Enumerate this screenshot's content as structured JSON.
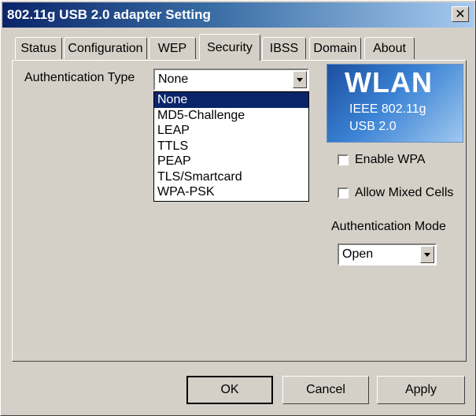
{
  "window": {
    "title": "802.11g USB 2.0 adapter Setting",
    "close_label": "✕"
  },
  "tabs": [
    "Status",
    "Configuration",
    "WEP",
    "Security",
    "IBSS",
    "Domain",
    "About"
  ],
  "active_tab": "Security",
  "security": {
    "auth_type_label": "Authentication Type",
    "auth_type_value": "None",
    "auth_type_options": [
      "None",
      "MD5-Challenge",
      "LEAP",
      "TTLS",
      "PEAP",
      "TLS/Smartcard",
      "WPA-PSK"
    ],
    "logo_title": "WLAN",
    "logo_line1": "IEEE 802.11g",
    "logo_line2": "USB 2.0",
    "enable_wpa_label": "Enable WPA",
    "enable_wpa_checked": false,
    "allow_mixed_label": "Allow Mixed Cells",
    "allow_mixed_checked": false,
    "auth_mode_label": "Authentication Mode",
    "auth_mode_value": "Open"
  },
  "buttons": {
    "ok": "OK",
    "cancel": "Cancel",
    "apply": "Apply"
  },
  "colors": {
    "title_start": "#0a246a",
    "title_end": "#a6caf0",
    "selection": "#0a246a",
    "face": "#d4d0c8"
  },
  "icons": {
    "close": "close-icon",
    "dropdown": "chevron-down-icon"
  }
}
